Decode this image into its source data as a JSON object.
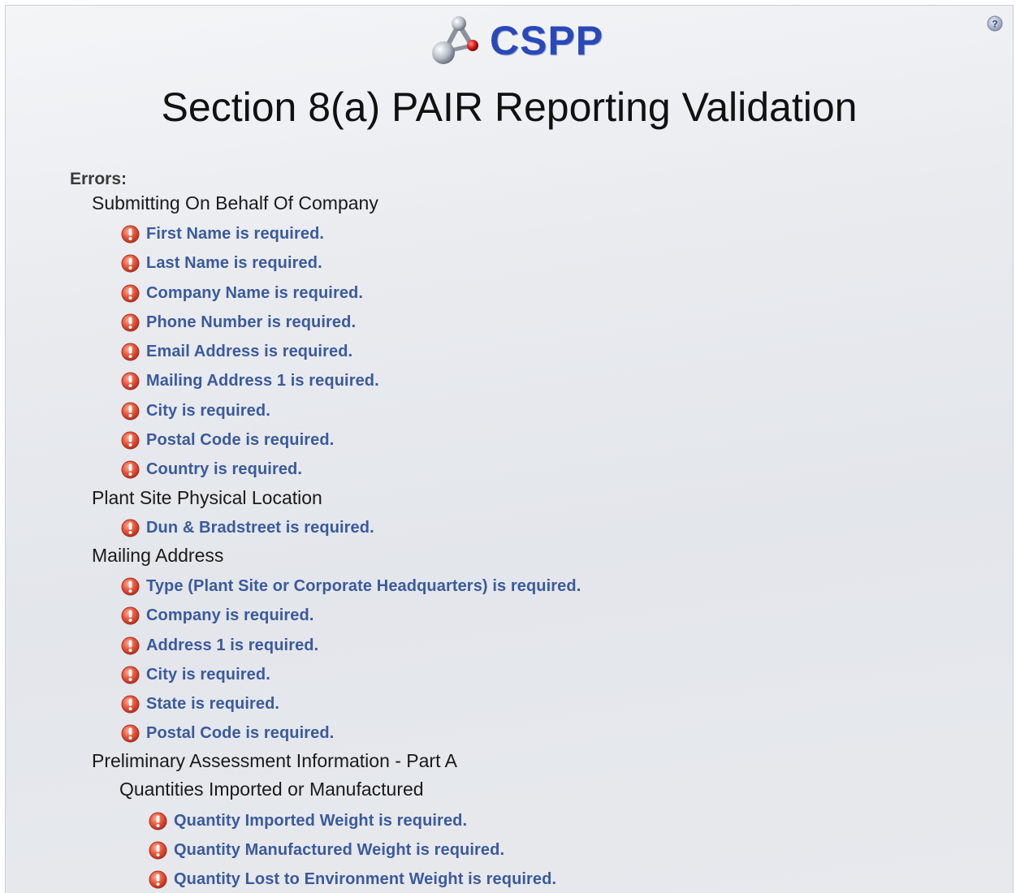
{
  "header": {
    "logo_text": "CSPP",
    "title": "Section 8(a) PAIR Reporting Validation"
  },
  "errors": {
    "heading": "Errors:",
    "groups": [
      {
        "title": "Submitting On Behalf Of Company",
        "items": [
          "First Name is required.",
          "Last Name is required.",
          "Company Name is required.",
          "Phone Number is required.",
          "Email Address is required.",
          "Mailing Address 1 is required.",
          "City is required.",
          "Postal Code is required.",
          "Country is required."
        ]
      },
      {
        "title": "Plant Site Physical Location",
        "items": [
          "Dun & Bradstreet is required."
        ]
      },
      {
        "title": "Mailing Address",
        "items": [
          "Type (Plant Site or Corporate Headquarters) is required.",
          "Company is required.",
          "Address 1 is required.",
          "City is required.",
          "State is required.",
          "Postal Code is required."
        ]
      },
      {
        "title": "Preliminary Assessment Information - Part A",
        "subgroups": [
          {
            "title": "Quantities Imported or Manufactured",
            "items": [
              "Quantity Imported Weight is required.",
              "Quantity Manufactured Weight is required.",
              "Quantity Lost to Environment Weight is required."
            ]
          }
        ]
      }
    ]
  },
  "icons": {
    "help": "help-icon",
    "error": "error-icon",
    "logo": "molecule-icon"
  },
  "colors": {
    "brand": "#2a49b8",
    "error_text": "#3b5a9c",
    "error_icon": "#e0503a"
  }
}
